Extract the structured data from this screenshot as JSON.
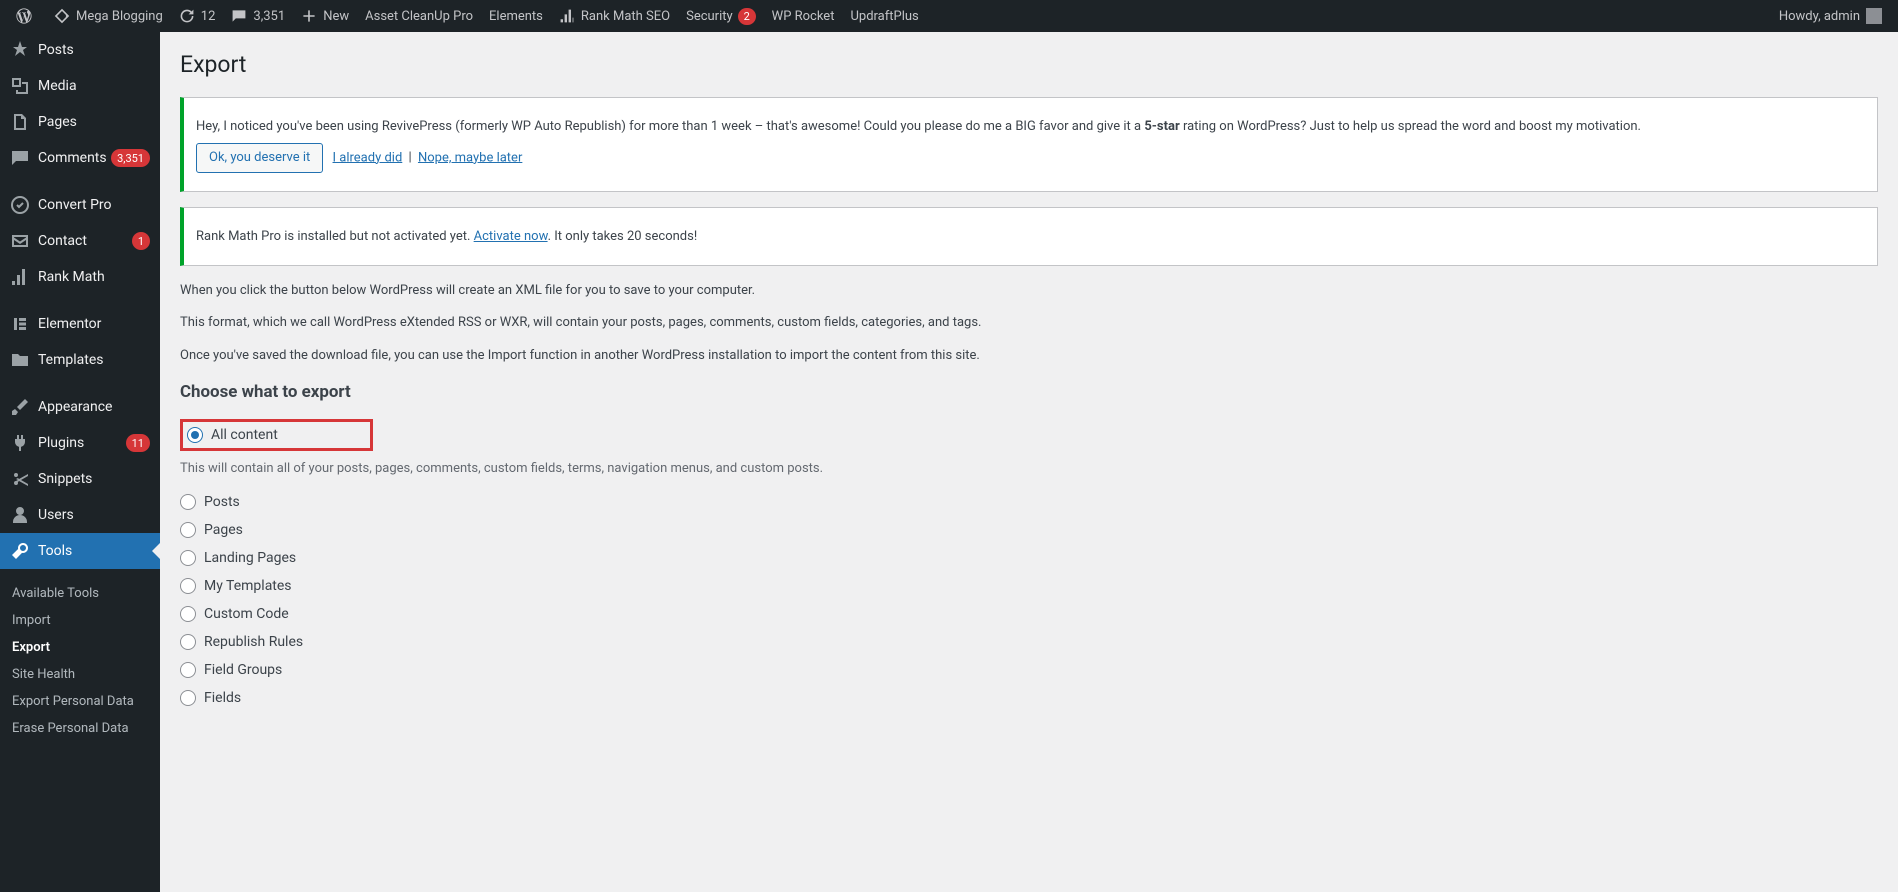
{
  "adminbar": {
    "site_name": "Mega Blogging",
    "updates": "12",
    "comments": "3,351",
    "new": "New",
    "items": [
      "Asset CleanUp Pro",
      "Elements",
      "Rank Math SEO",
      "Security",
      "WP Rocket",
      "UpdraftPlus"
    ],
    "security_badge": "2",
    "howdy": "Howdy, admin"
  },
  "sidebar": {
    "items": [
      {
        "label": "Posts",
        "icon": "pin"
      },
      {
        "label": "Media",
        "icon": "media"
      },
      {
        "label": "Pages",
        "icon": "page"
      },
      {
        "label": "Comments",
        "icon": "comment",
        "badge": "3,351"
      },
      {
        "label": "Convert Pro",
        "icon": "convert"
      },
      {
        "label": "Contact",
        "icon": "mail",
        "badge": "1"
      },
      {
        "label": "Rank Math",
        "icon": "chart"
      },
      {
        "label": "Elementor",
        "icon": "elementor"
      },
      {
        "label": "Templates",
        "icon": "folder"
      },
      {
        "label": "Appearance",
        "icon": "brush"
      },
      {
        "label": "Plugins",
        "icon": "plug",
        "badge": "11"
      },
      {
        "label": "Snippets",
        "icon": "scissors"
      },
      {
        "label": "Users",
        "icon": "user"
      },
      {
        "label": "Tools",
        "icon": "wrench",
        "current": true
      }
    ],
    "submenu": [
      {
        "label": "Available Tools"
      },
      {
        "label": "Import"
      },
      {
        "label": "Export",
        "current": true
      },
      {
        "label": "Site Health"
      },
      {
        "label": "Export Personal Data"
      },
      {
        "label": "Erase Personal Data"
      }
    ]
  },
  "page": {
    "title": "Export",
    "notice1_text_a": "Hey, I noticed you've been using RevivePress (formerly WP Auto Republish) for more than 1 week – that's awesome! Could you please do me a BIG favor and give it a ",
    "notice1_text_b": "5-star",
    "notice1_text_c": " rating on WordPress? Just to help us spread the word and boost my motivation.",
    "notice1_btn": "Ok, you deserve it",
    "notice1_link1": "I already did",
    "notice1_link2": "Nope, maybe later",
    "notice2_a": "Rank Math Pro is installed but not activated yet. ",
    "notice2_link": "Activate now",
    "notice2_b": ". It only takes 20 seconds!",
    "intro1": "When you click the button below WordPress will create an XML file for you to save to your computer.",
    "intro2": "This format, which we call WordPress eXtended RSS or WXR, will contain your posts, pages, comments, custom fields, categories, and tags.",
    "intro3": "Once you've saved the download file, you can use the Import function in another WordPress installation to import the content from this site.",
    "choose_heading": "Choose what to export",
    "all_content": "All content",
    "all_content_desc": "This will contain all of your posts, pages, comments, custom fields, terms, navigation menus, and custom posts.",
    "radios": [
      "Posts",
      "Pages",
      "Landing Pages",
      "My Templates",
      "Custom Code",
      "Republish Rules",
      "Field Groups",
      "Fields"
    ]
  }
}
